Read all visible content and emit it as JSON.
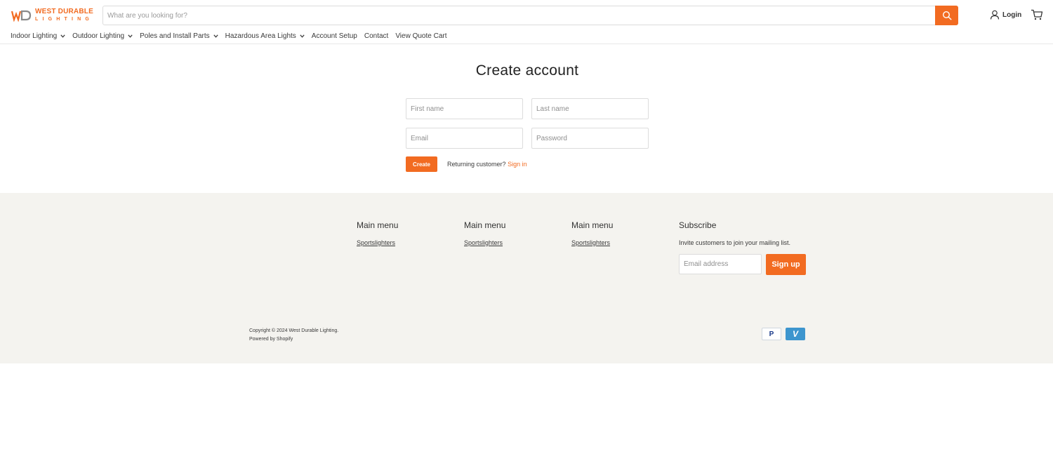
{
  "brand": {
    "logo_top": "WEST DURABLE",
    "logo_bottom": "LIGHTING",
    "accent_color": "#f26b21"
  },
  "search": {
    "placeholder": "What are you looking for?",
    "icon": "search-icon"
  },
  "header": {
    "login_label": "Login",
    "login_icon": "user-icon",
    "cart_icon": "cart-icon"
  },
  "nav": {
    "items": [
      {
        "label": "Indoor Lighting",
        "dropdown": true
      },
      {
        "label": "Outdoor Lighting",
        "dropdown": true
      },
      {
        "label": "Poles and Install Parts",
        "dropdown": true
      },
      {
        "label": "Hazardous Area Lights",
        "dropdown": true
      },
      {
        "label": "Account Setup",
        "dropdown": false
      },
      {
        "label": "Contact",
        "dropdown": false
      },
      {
        "label": "View Quote Cart",
        "dropdown": false
      }
    ]
  },
  "form": {
    "title": "Create account",
    "first_name_placeholder": "First name",
    "last_name_placeholder": "Last name",
    "email_placeholder": "Email",
    "password_placeholder": "Password",
    "create_label": "Create",
    "returning_text": "Returning customer?",
    "sign_in_label": "Sign in"
  },
  "footer": {
    "columns": [
      {
        "heading": "Main menu",
        "link": "Sportslighters"
      },
      {
        "heading": "Main menu",
        "link": "Sportslighters"
      },
      {
        "heading": "Main menu",
        "link": "Sportslighters"
      }
    ],
    "subscribe": {
      "heading": "Subscribe",
      "text": "Invite customers to join your mailing list.",
      "email_placeholder": "Email address",
      "button_label": "Sign up"
    },
    "copyright": "Copyright © 2024 West Durable Lighting.",
    "powered_by": "Powered by Shopify",
    "payments": [
      {
        "name": "paypal-icon",
        "glyph": "P"
      },
      {
        "name": "venmo-icon",
        "glyph": "V"
      }
    ]
  }
}
